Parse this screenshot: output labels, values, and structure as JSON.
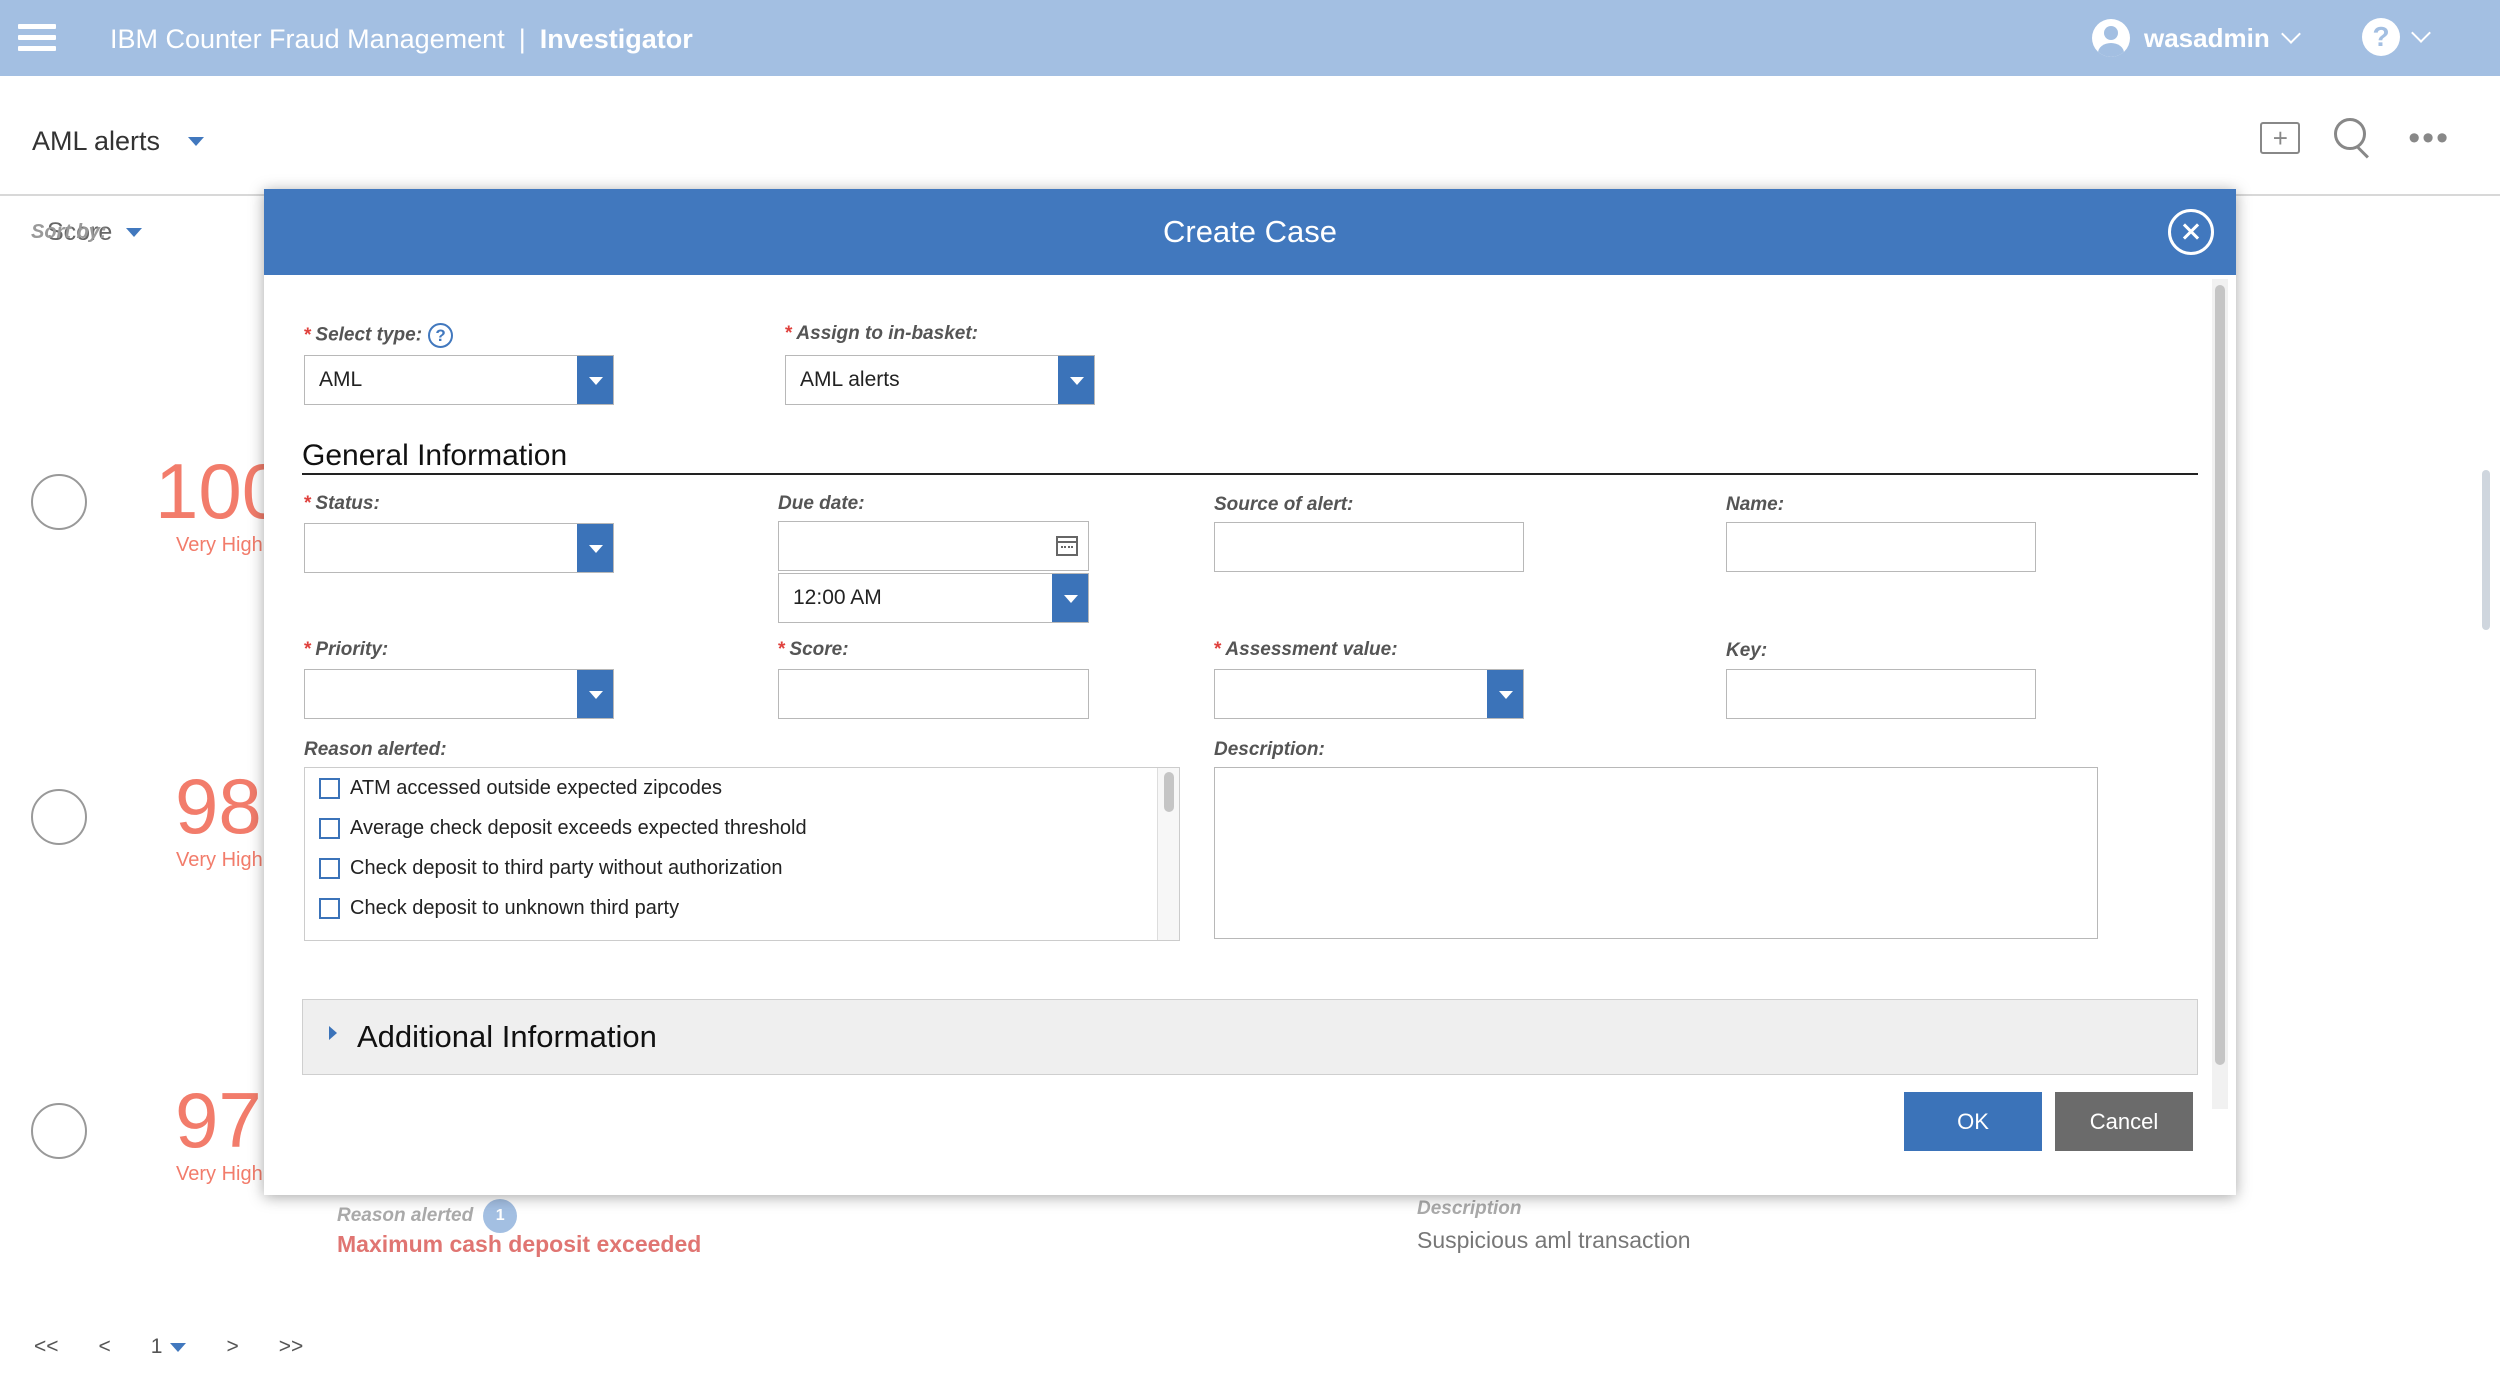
{
  "topbar": {
    "product": "IBM Counter Fraud Management",
    "separator": "|",
    "role": "Investigator",
    "user": "wasadmin",
    "help_glyph": "?"
  },
  "subheader": {
    "view_title": "AML alerts",
    "icons": [
      "add-folder-icon",
      "search-icon",
      "more-icon"
    ],
    "more_glyph": "•••"
  },
  "sort": {
    "label": "Sort by:",
    "value": "Score"
  },
  "alerts": [
    {
      "score": "100",
      "level": "Very High"
    },
    {
      "score": "98",
      "level": "Very High"
    },
    {
      "score": "97",
      "level": "Very High"
    }
  ],
  "background_detail": {
    "reason_label": "Reason alerted",
    "reason_count": "1",
    "reason": "Maximum cash deposit exceeded",
    "description_label": "Description",
    "description": "Suspicious aml transaction"
  },
  "pager": {
    "first": "<<",
    "prev": "<",
    "page": "1",
    "next": ">",
    "last": ">>"
  },
  "modal": {
    "title": "Create Case",
    "fields": {
      "select_type": {
        "label": "Select type:",
        "value": "AML",
        "required": true
      },
      "inbasket": {
        "label": "Assign to in-basket:",
        "value": "AML alerts",
        "required": true
      },
      "status": {
        "label": "Status:",
        "value": "",
        "required": true
      },
      "due_date": {
        "label": "Due date:",
        "value": "",
        "time": "12:00 AM"
      },
      "source": {
        "label": "Source of alert:",
        "value": ""
      },
      "name": {
        "label": "Name:",
        "value": ""
      },
      "priority": {
        "label": "Priority:",
        "value": "",
        "required": true
      },
      "score": {
        "label": "Score:",
        "value": "",
        "required": true
      },
      "assessment": {
        "label": "Assessment value:",
        "value": "",
        "required": true
      },
      "key": {
        "label": "Key:",
        "value": ""
      },
      "reason_alerted": {
        "label": "Reason alerted:"
      },
      "description": {
        "label": "Description:",
        "value": ""
      }
    },
    "required_marker": "*",
    "help_glyph": "?",
    "general_section": "General Information",
    "reasons": [
      "ATM accessed outside expected zipcodes",
      "Average check deposit exceeds expected threshold",
      "Check deposit to third party without authorization",
      "Check deposit to unknown third party"
    ],
    "additional_section": "Additional Information",
    "ok_label": "OK",
    "cancel_label": "Cancel"
  },
  "colors": {
    "topbar": "#a3bfe2",
    "modal_header": "#4178be",
    "primary_button": "#3b73b9",
    "secondary_button": "#6b6b6b",
    "score_text": "#f27c6b",
    "required": "#e0413d"
  }
}
